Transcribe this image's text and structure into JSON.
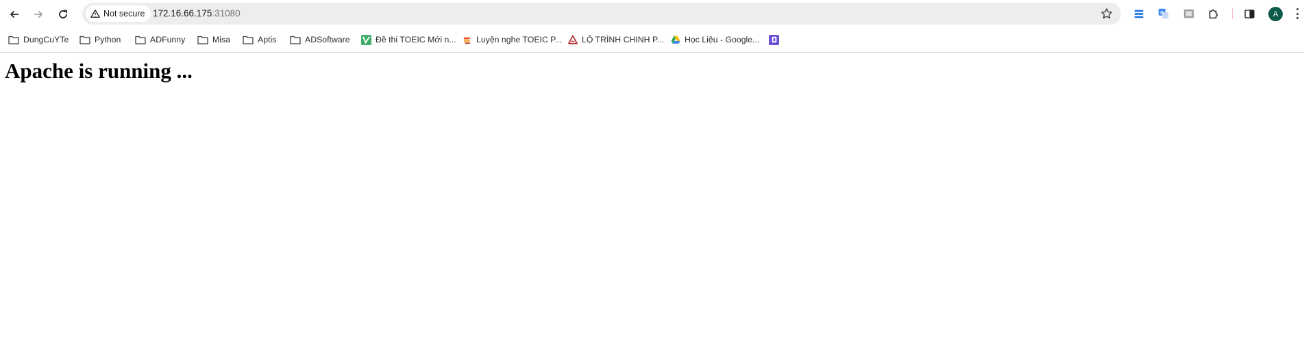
{
  "toolbar": {
    "security_label": "Not secure",
    "url_host": "172.16.66.175",
    "url_port": ":31080"
  },
  "profile": {
    "initial": "A",
    "color": "#0c5a4a"
  },
  "bookmarks": [
    {
      "label": "DungCuYTe",
      "icon": "folder-icon"
    },
    {
      "label": "Python",
      "icon": "folder-icon"
    },
    {
      "label": "ADFunny",
      "icon": "folder-icon"
    },
    {
      "label": "Misa",
      "icon": "folder-icon"
    },
    {
      "label": "Aptis",
      "icon": "folder-icon"
    },
    {
      "label": "ADSoftware",
      "icon": "folder-icon"
    },
    {
      "label": "Đề thi TOEIC Mới n...",
      "icon": "toeic-favicon"
    },
    {
      "label": "Luyện nghe TOEIC P...",
      "icon": "listening-favicon"
    },
    {
      "label": "LỘ TRÌNH CHINH P...",
      "icon": "red-a-favicon"
    },
    {
      "label": "Học Liệu - Google...",
      "icon": "google-drive-icon"
    },
    {
      "label": "",
      "icon": "purple-app-favicon"
    }
  ],
  "page": {
    "heading": "Apache is running ..."
  }
}
